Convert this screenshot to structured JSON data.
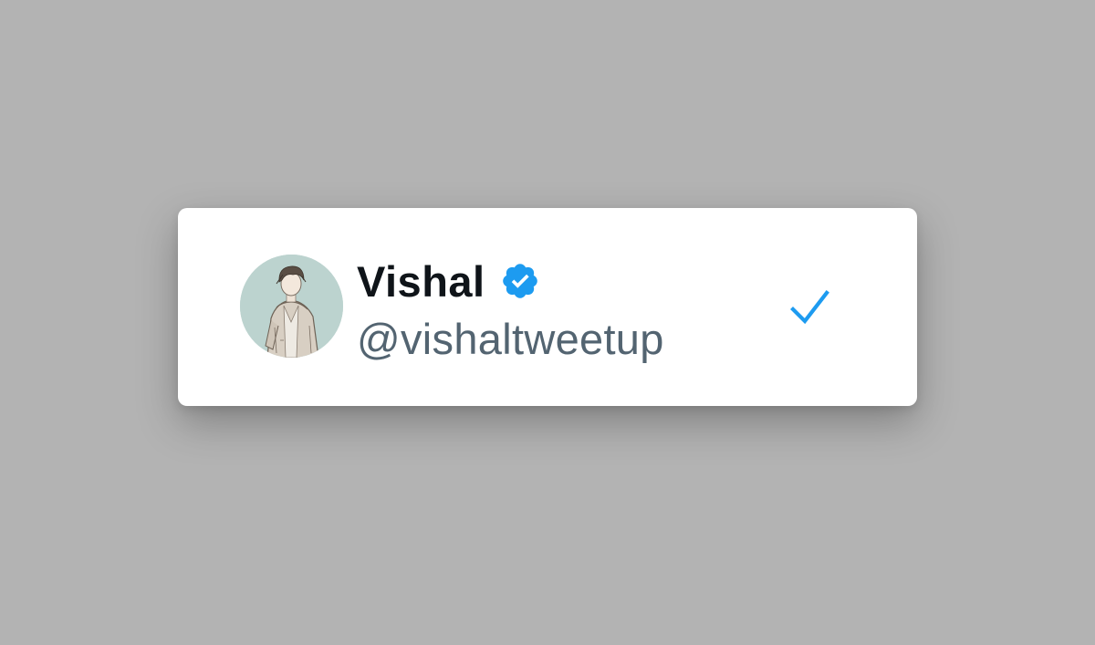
{
  "account": {
    "display_name": "Vishal",
    "handle": "@vishaltweetup",
    "verified": true,
    "selected": true
  },
  "icons": {
    "avatar": "avatar-illustration",
    "verified": "verified-badge-icon",
    "selected": "checkmark-icon"
  },
  "colors": {
    "background": "#b3b3b3",
    "card": "#ffffff",
    "name": "#0f1419",
    "handle": "#536471",
    "accent": "#1d9bf0",
    "avatar_bg": "#bcd3cf"
  }
}
